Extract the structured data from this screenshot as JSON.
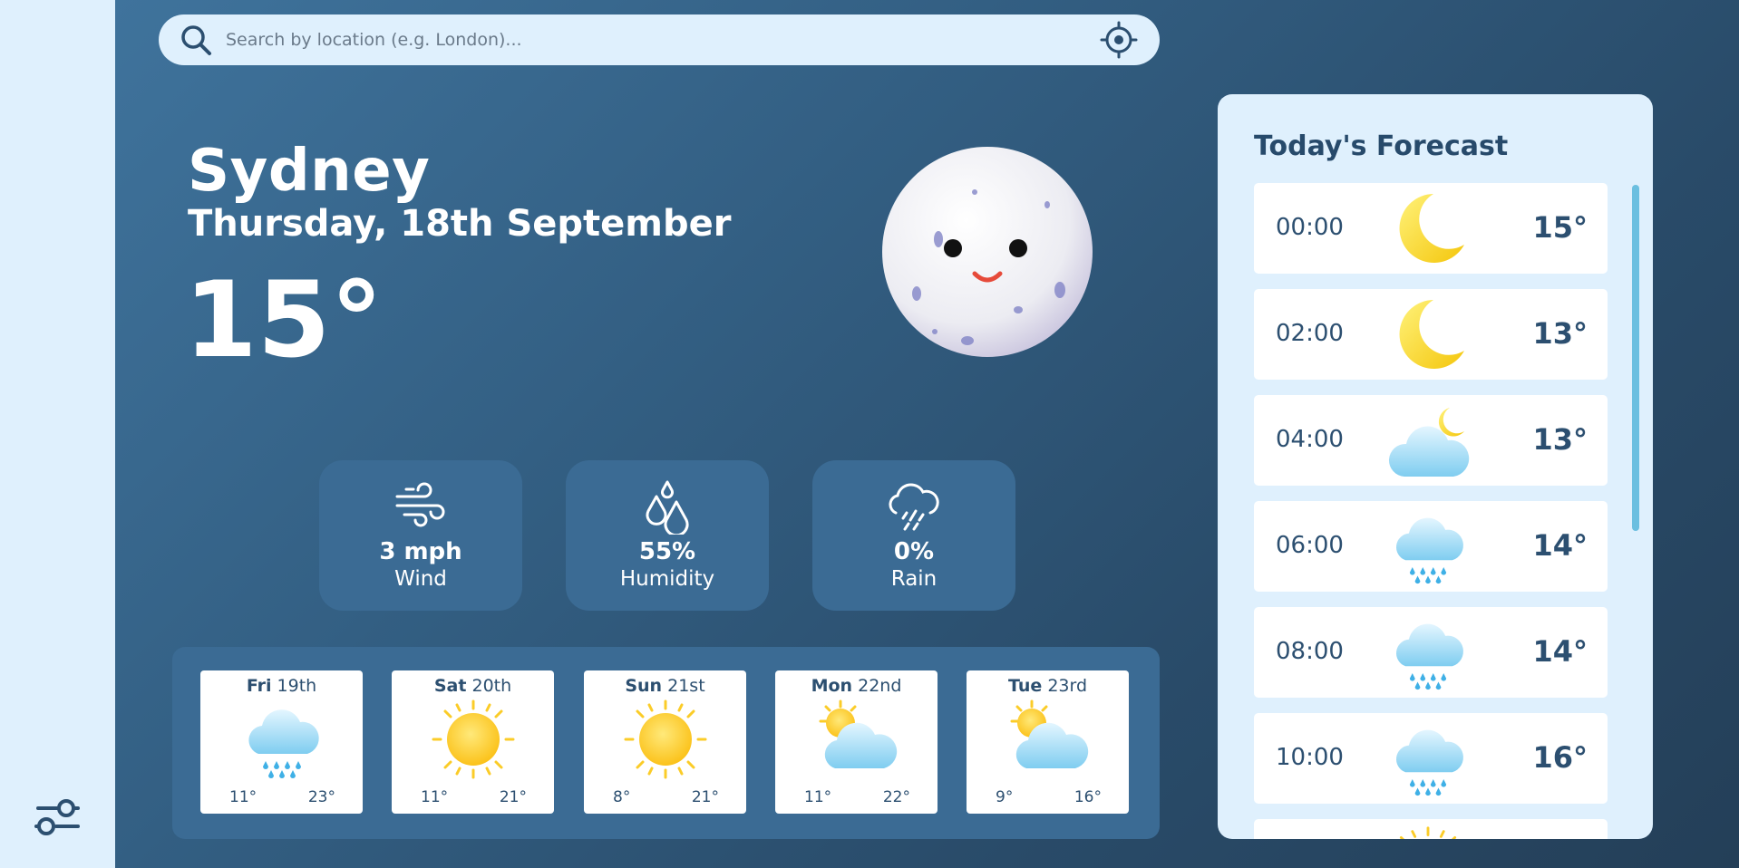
{
  "search": {
    "placeholder": "Search by location (e.g. London)..."
  },
  "current": {
    "city": "Sydney",
    "date": "Thursday, 18th September",
    "temp": "15°",
    "icon": "moon-face-icon"
  },
  "stats": [
    {
      "value": "3 mph",
      "label": "Wind",
      "icon": "wind-icon"
    },
    {
      "value": "55%",
      "label": "Humidity",
      "icon": "humidity-drops-icon"
    },
    {
      "value": "0%",
      "label": "Rain",
      "icon": "rain-cloud-icon"
    }
  ],
  "week": [
    {
      "day": "Fri",
      "date": "19th",
      "low": "11°",
      "high": "23°",
      "icon": "rain-cloud-icon"
    },
    {
      "day": "Sat",
      "date": "20th",
      "low": "11°",
      "high": "21°",
      "icon": "sun-icon"
    },
    {
      "day": "Sun",
      "date": "21st",
      "low": "8°",
      "high": "21°",
      "icon": "sun-icon"
    },
    {
      "day": "Mon",
      "date": "22nd",
      "low": "11°",
      "high": "22°",
      "icon": "partly-cloudy-icon"
    },
    {
      "day": "Tue",
      "date": "23rd",
      "low": "9°",
      "high": "16°",
      "icon": "partly-cloudy-icon"
    }
  ],
  "forecast": {
    "title": "Today's Forecast",
    "hours": [
      {
        "time": "00:00",
        "temp": "15°",
        "icon": "moon-icon"
      },
      {
        "time": "02:00",
        "temp": "13°",
        "icon": "moon-icon"
      },
      {
        "time": "04:00",
        "temp": "13°",
        "icon": "cloudy-night-icon"
      },
      {
        "time": "06:00",
        "temp": "14°",
        "icon": "rain-cloud-icon"
      },
      {
        "time": "08:00",
        "temp": "14°",
        "icon": "rain-cloud-icon"
      },
      {
        "time": "10:00",
        "temp": "16°",
        "icon": "rain-cloud-icon"
      }
    ]
  },
  "colors": {
    "panel": "#dff0fd",
    "card": "#3b6b94",
    "text_dark": "#2c4f70",
    "accent_scroll": "#6bbfe0"
  }
}
